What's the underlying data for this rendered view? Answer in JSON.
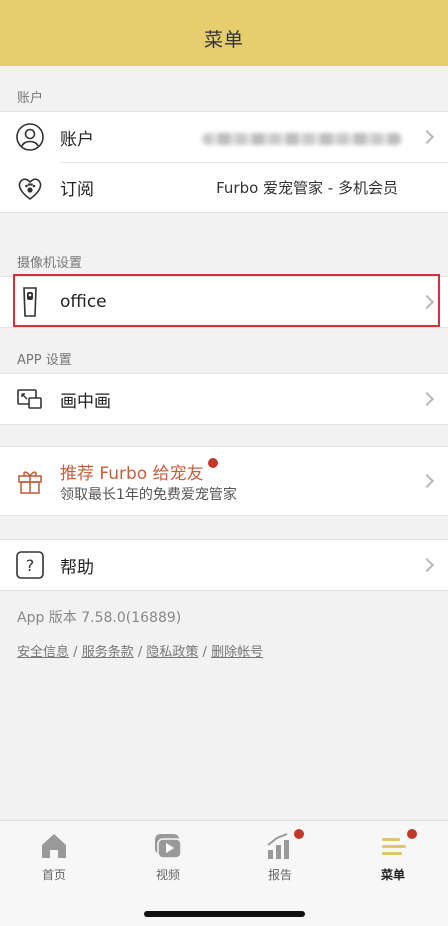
{
  "header": {
    "title": "菜单"
  },
  "account_section": {
    "label": "账户",
    "items": [
      {
        "label": "账户",
        "value": "",
        "icon": "user-icon"
      },
      {
        "label": "订阅",
        "value": "Furbo 爱宠管家 - 多机会员",
        "icon": "paw-heart-icon"
      }
    ]
  },
  "camera_section": {
    "label": "摄像机设置",
    "items": [
      {
        "label": "office",
        "icon": "camera-device-icon"
      }
    ]
  },
  "app_section": {
    "label": "APP 设置",
    "items": [
      {
        "label": "画中画",
        "icon": "picture-in-picture-icon"
      }
    ]
  },
  "promo": {
    "title": "推荐 Furbo 给宠友",
    "subtitle": "领取最长1年的免费爱宠管家",
    "icon": "gift-icon",
    "accent": "#c5603f"
  },
  "help": {
    "label": "帮助",
    "icon": "question-icon"
  },
  "footer": {
    "version": "App 版本 7.58.0(16889)",
    "links": [
      "安全信息",
      "服务条款",
      "隐私政策",
      "删除帐号"
    ],
    "separator": "/"
  },
  "tabbar": {
    "tabs": [
      {
        "label": "首页",
        "icon": "home-icon",
        "badge": false
      },
      {
        "label": "视频",
        "icon": "video-icon",
        "badge": false
      },
      {
        "label": "报告",
        "icon": "report-chart-icon",
        "badge": true
      },
      {
        "label": "菜单",
        "icon": "menu-icon",
        "badge": true,
        "active": true
      }
    ]
  },
  "colors": {
    "header": "#e6cd6e",
    "highlight": "#d1333a",
    "badge": "#c0392b"
  }
}
